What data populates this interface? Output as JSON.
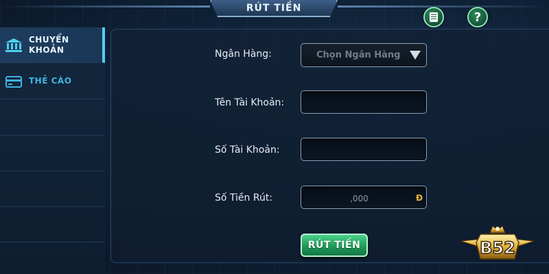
{
  "header": {
    "title": "RÚT TIỀN"
  },
  "top_buttons": {
    "help_label": "?"
  },
  "sidebar": {
    "items": [
      {
        "label": "CHUYỂN KHOẢN",
        "icon": "bank-icon",
        "active": true
      },
      {
        "label": "THẺ CÀO",
        "icon": "card-icon",
        "active": false
      }
    ]
  },
  "form": {
    "bank_label": "Ngân Hàng:",
    "bank_select_value": "Chọn Ngân Hàng",
    "account_name_label": "Tên Tài Khoản:",
    "account_name_value": "",
    "account_number_label": "Số Tài Khoản:",
    "account_number_value": "",
    "amount_label": "Số Tiền Rút:",
    "amount_placeholder": ",000",
    "currency_symbol": "Đ",
    "submit_label": "RÚT TIỀN"
  },
  "brand": {
    "logo_text": "B52"
  },
  "colors": {
    "accent": "#4fd0f2",
    "submit_green": "#1f9a58",
    "currency_gold": "#e8b23d"
  }
}
